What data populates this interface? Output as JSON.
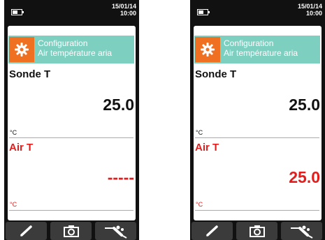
{
  "colors": {
    "header_bg": "#7dcfc0",
    "icon_bg": "#f07021",
    "alert_red": "#e31c1c",
    "device_body": "#111111"
  },
  "devices": [
    {
      "date": "15/01/14",
      "time": "10:00",
      "config_title": "Configuration",
      "config_subtitle": "Air température aria",
      "probe_label": "Sonde T",
      "probe_value": "25.0",
      "probe_unit": "°C",
      "air_label": "Air T",
      "air_value": "-----",
      "air_unit": "°C"
    },
    {
      "date": "15/01/14",
      "time": "10:00",
      "config_title": "Configuration",
      "config_subtitle": "Air température aria",
      "probe_label": "Sonde T",
      "probe_value": "25.0",
      "probe_unit": "°C",
      "air_label": "Air T",
      "air_value": "25.0",
      "air_unit": "°C"
    }
  ],
  "toolbar": {
    "icons": [
      "pencil-icon",
      "camera-icon",
      "probe-icon"
    ]
  }
}
